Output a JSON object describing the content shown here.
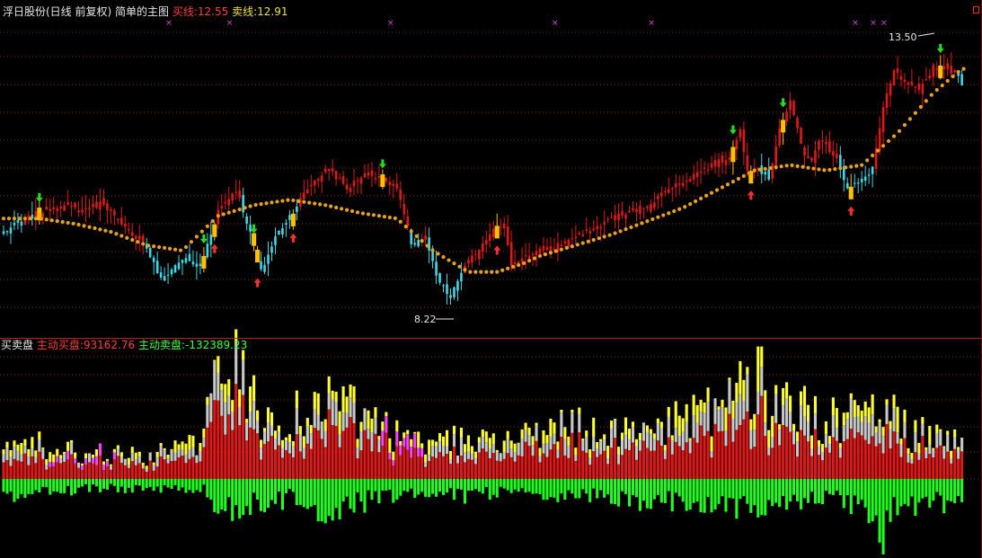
{
  "main_header": {
    "title": "浮日股份(日线 前复权) 简单的主图",
    "buy_line_label": "买线:",
    "buy_line_value": "12.55",
    "sell_line_label": "卖线:",
    "sell_line_value": "12.91"
  },
  "sub_header": {
    "title": "买卖盘",
    "active_buy_label": "主动买盘:",
    "active_buy_value": "93162.76",
    "active_sell_label": "主动卖盘:",
    "active_sell_value": "-132389.23"
  },
  "colors": {
    "background": "#000000",
    "up_candle": "#e01818",
    "down_candle": "#40d8e8",
    "signal_candle": "#ffc000",
    "ma_dots": "#e8a020",
    "buy_volume": "#e01818",
    "buy_volume_top": "#ffff30",
    "buy_volume_grey": "#c8c8c8",
    "buy_volume_magenta": "#ff40ff",
    "sell_volume": "#20ff20",
    "buy_arrow": "#ff3030",
    "sell_arrow": "#20e020",
    "grid": "#802020"
  },
  "chart_data": [
    {
      "type": "candlestick",
      "name": "price",
      "annotations": [
        {
          "text": "13.50",
          "kind": "high-marker"
        },
        {
          "text": "8.22",
          "kind": "low-marker"
        }
      ],
      "price_anchors": {
        "high": 13.5,
        "low": 8.22
      },
      "close_path": [
        [
          0,
          9.8
        ],
        [
          8,
          10.1
        ],
        [
          15,
          10.3
        ],
        [
          22,
          10.2
        ],
        [
          28,
          10.35
        ],
        [
          33,
          9.9
        ],
        [
          38,
          9.7
        ],
        [
          40,
          9.5
        ],
        [
          44,
          8.9
        ],
        [
          50,
          9.3
        ],
        [
          55,
          9.15
        ],
        [
          60,
          10.2
        ],
        [
          65,
          10.6
        ],
        [
          68,
          10.0
        ],
        [
          72,
          9.05
        ],
        [
          76,
          9.7
        ],
        [
          81,
          10.2
        ],
        [
          86,
          10.7
        ],
        [
          91,
          11.0
        ],
        [
          96,
          10.6
        ],
        [
          101,
          10.9
        ],
        [
          106,
          10.8
        ],
        [
          110,
          10.6
        ],
        [
          114,
          9.6
        ],
        [
          118,
          9.7
        ],
        [
          121,
          8.95
        ],
        [
          125,
          8.55
        ],
        [
          128,
          9.05
        ],
        [
          132,
          9.4
        ],
        [
          136,
          9.8
        ],
        [
          140,
          9.95
        ],
        [
          142,
          9.2
        ],
        [
          145,
          9.25
        ],
        [
          150,
          9.45
        ],
        [
          155,
          9.55
        ],
        [
          160,
          9.7
        ],
        [
          165,
          9.85
        ],
        [
          170,
          10.05
        ],
        [
          175,
          10.15
        ],
        [
          180,
          10.3
        ],
        [
          185,
          10.55
        ],
        [
          190,
          10.75
        ],
        [
          195,
          10.95
        ],
        [
          200,
          11.1
        ],
        [
          203,
          11.2
        ],
        [
          206,
          11.7
        ],
        [
          208,
          11.0
        ],
        [
          211,
          11.0
        ],
        [
          214,
          10.8
        ],
        [
          217,
          11.75
        ],
        [
          220,
          12.2
        ],
        [
          224,
          11.25
        ],
        [
          226,
          11.1
        ],
        [
          228,
          11.55
        ],
        [
          233,
          11.2
        ],
        [
          236,
          10.6
        ],
        [
          240,
          10.75
        ],
        [
          243,
          11.0
        ],
        [
          246,
          12.1
        ],
        [
          249,
          12.8
        ],
        [
          252,
          12.6
        ],
        [
          256,
          12.4
        ],
        [
          260,
          12.9
        ],
        [
          264,
          12.9
        ],
        [
          268,
          12.6
        ]
      ],
      "ma_path": [
        [
          0,
          10.05
        ],
        [
          10,
          10.05
        ],
        [
          20,
          9.95
        ],
        [
          30,
          9.8
        ],
        [
          40,
          9.55
        ],
        [
          50,
          9.45
        ],
        [
          60,
          10.1
        ],
        [
          70,
          10.3
        ],
        [
          80,
          10.4
        ],
        [
          90,
          10.3
        ],
        [
          100,
          10.15
        ],
        [
          110,
          10.05
        ],
        [
          120,
          9.45
        ],
        [
          130,
          9.05
        ],
        [
          138,
          9.05
        ],
        [
          145,
          9.2
        ],
        [
          150,
          9.35
        ],
        [
          160,
          9.55
        ],
        [
          170,
          9.75
        ],
        [
          180,
          10.0
        ],
        [
          190,
          10.25
        ],
        [
          200,
          10.6
        ],
        [
          210,
          10.95
        ],
        [
          220,
          11.05
        ],
        [
          230,
          10.95
        ],
        [
          240,
          11.05
        ],
        [
          250,
          11.65
        ],
        [
          260,
          12.4
        ],
        [
          268,
          12.85
        ]
      ],
      "buy_signals": [
        59,
        71,
        81,
        138,
        209,
        237
      ],
      "sell_signals": [
        10,
        56,
        70,
        106,
        204,
        218,
        262
      ],
      "top_markers": [
        46,
        63,
        108,
        154,
        181,
        238,
        243,
        246
      ]
    },
    {
      "type": "bar",
      "name": "volume",
      "series": [
        {
          "name": "主动买盘",
          "total": 93162.76
        },
        {
          "name": "主动卖盘",
          "total": -132389.23
        }
      ]
    }
  ]
}
